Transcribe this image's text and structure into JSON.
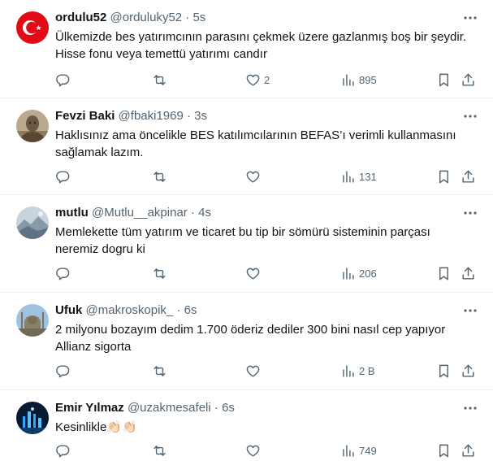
{
  "tweets": [
    {
      "name": "ordulu52",
      "handle": "@orduluky52",
      "separator": "·",
      "time": "5s",
      "text_lines": [
        "Ülkemizde bes yatırımcının parasını çekmek üzere gazlanmış boş bir şeydir.",
        "Hisse fonu veya temettü yatırımı candır"
      ],
      "likes": "2",
      "views": "895",
      "avatar": "turkish-flag"
    },
    {
      "name": "Fevzi Baki",
      "handle": "@fbaki1969",
      "separator": "·",
      "time": "3s",
      "text_lines": [
        "Haklısınız ama öncelikle BES katılımcılarının BEFAS’ı verimli kullanmasını",
        "sağlamak lazım."
      ],
      "likes": "",
      "views": "131",
      "avatar": "statue-photo"
    },
    {
      "name": "mutlu",
      "handle": "@Mutlu__akpinar",
      "separator": "·",
      "time": "4s",
      "text_lines": [
        "Memlekette tüm yatırım ve ticaret bu tip bir sömürü sisteminin parçası",
        "neremiz dogru ki"
      ],
      "likes": "",
      "views": "206",
      "avatar": "landscape-photo"
    },
    {
      "name": "Ufuk",
      "handle": "@makroskopik_",
      "separator": "·",
      "time": "6s",
      "text_lines": [
        "2 milyonu bozayım dedim 1.700 öderiz dediler 300 bini nasıl cep yapıyor",
        "Allianz sigorta"
      ],
      "likes": "",
      "views": "2 B",
      "avatar": "mosque-photo"
    },
    {
      "name": "Emir Yılmaz",
      "handle": "@uzakmesafeli",
      "separator": "·",
      "time": "6s",
      "text_lines": [
        "Kesinlikle👏🏻👏🏻"
      ],
      "likes": "",
      "views": "749",
      "avatar": "city-lights-photo"
    }
  ],
  "colors": {
    "text": "#0f1419",
    "secondary": "#536471",
    "divider": "#eff3f4",
    "flag_red": "#e30a17"
  }
}
